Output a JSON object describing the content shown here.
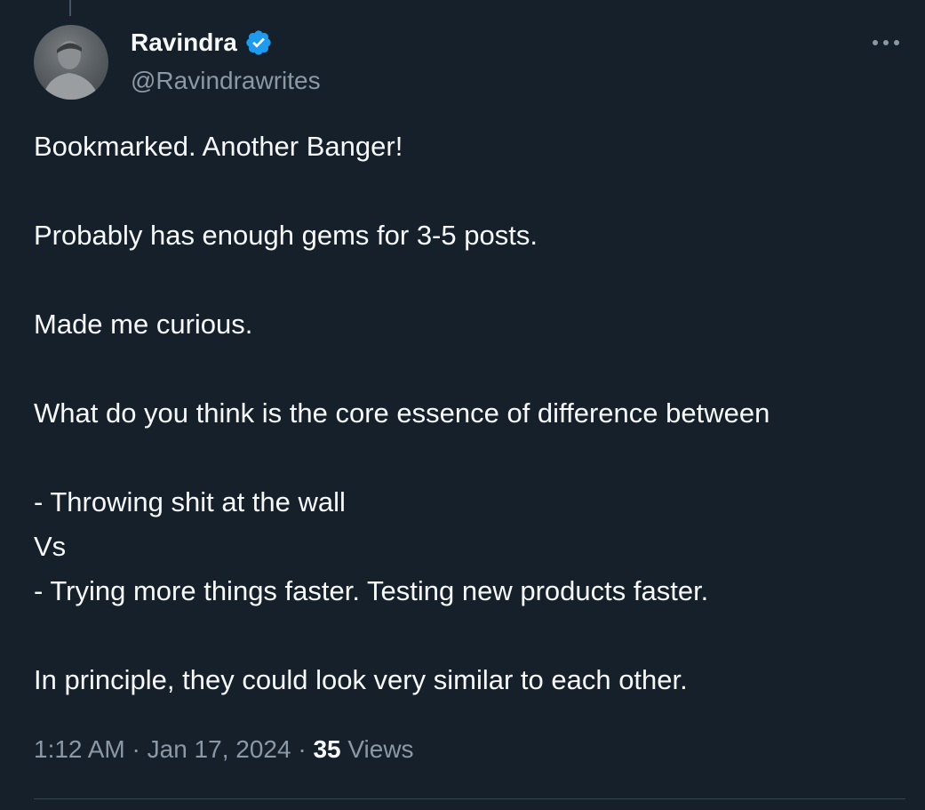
{
  "author": {
    "name": "Ravindra",
    "handle": "@Ravindrawrites",
    "verified": true,
    "verified_color": "#1d9bf0"
  },
  "icons": {
    "verified": "verified-badge-icon",
    "more": "more-options-icon",
    "avatar": "profile-avatar"
  },
  "post": {
    "lines": [
      "Bookmarked. Another Banger!",
      "",
      "Probably has enough gems for 3-5 posts.",
      "",
      "Made me curious.",
      "",
      "What do you think is the core essence of difference between",
      "",
      "- Throwing shit at the wall",
      "Vs",
      "- Trying more things faster. Testing new products faster.",
      "",
      "In principle, they could look very similar to each other."
    ]
  },
  "meta": {
    "time": "1:12 AM",
    "separator": "·",
    "date": "Jan 17, 2024",
    "views_count": "35",
    "views_label": "Views"
  },
  "colors": {
    "background": "#15202b",
    "text_primary": "#f7f9f9",
    "text_secondary": "#8b98a5",
    "divider": "#38444d"
  }
}
